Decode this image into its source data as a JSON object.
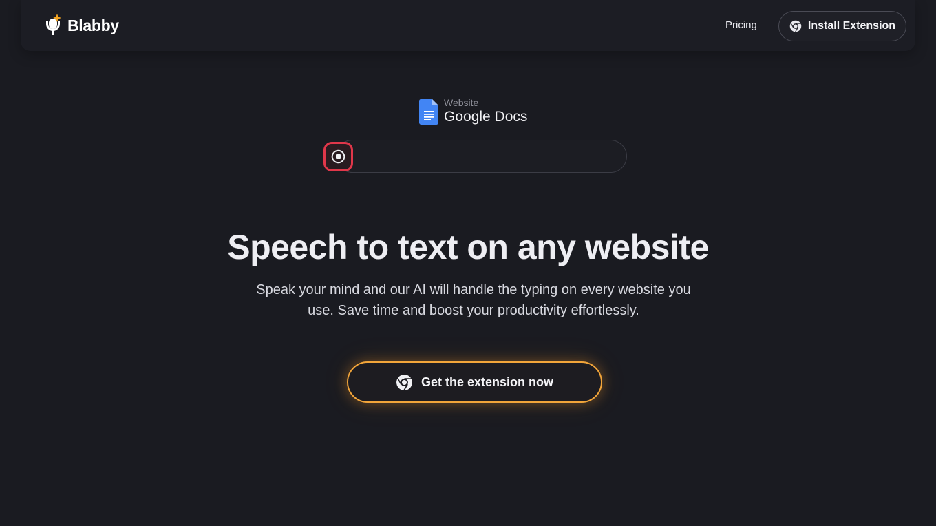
{
  "header": {
    "logo_text": "Blabby",
    "nav": {
      "pricing_label": "Pricing"
    },
    "install_label": "Install Extension"
  },
  "site": {
    "caption": "Website",
    "name": "Google Docs"
  },
  "recorder": {
    "state": "recording",
    "button_icon": "stop-icon"
  },
  "hero": {
    "title": "Speech to text on any website",
    "subtitle": "Speak your mind and our AI will handle the typing on every website you use. Save time and boost your productivity effortlessly.",
    "cta_label": "Get the extension now"
  },
  "colors": {
    "background": "#1a1b21",
    "accent_orange": "#f2a53a",
    "record_red": "#e0374a",
    "docs_blue": "#4285f4"
  },
  "icons": {
    "logo": "microphone-sparkle-icon",
    "browser": "chrome-icon",
    "site": "google-docs-icon"
  }
}
